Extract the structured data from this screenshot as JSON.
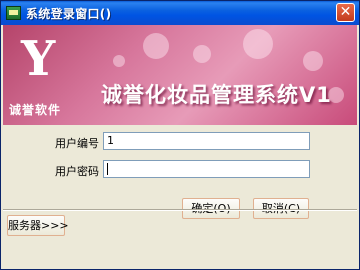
{
  "window": {
    "title": "系统登录窗口()"
  },
  "banner": {
    "logo_mark": "Y",
    "logo_name": "诚誉软件",
    "app_title": "诚誉化妆品管理系统V1"
  },
  "form": {
    "user_id_label": "用户编号",
    "user_id_value": "1",
    "password_label": "用户密码",
    "password_value": ""
  },
  "buttons": {
    "ok": "确定(O)",
    "cancel": "取消(C)",
    "server": "服务器>>>"
  }
}
